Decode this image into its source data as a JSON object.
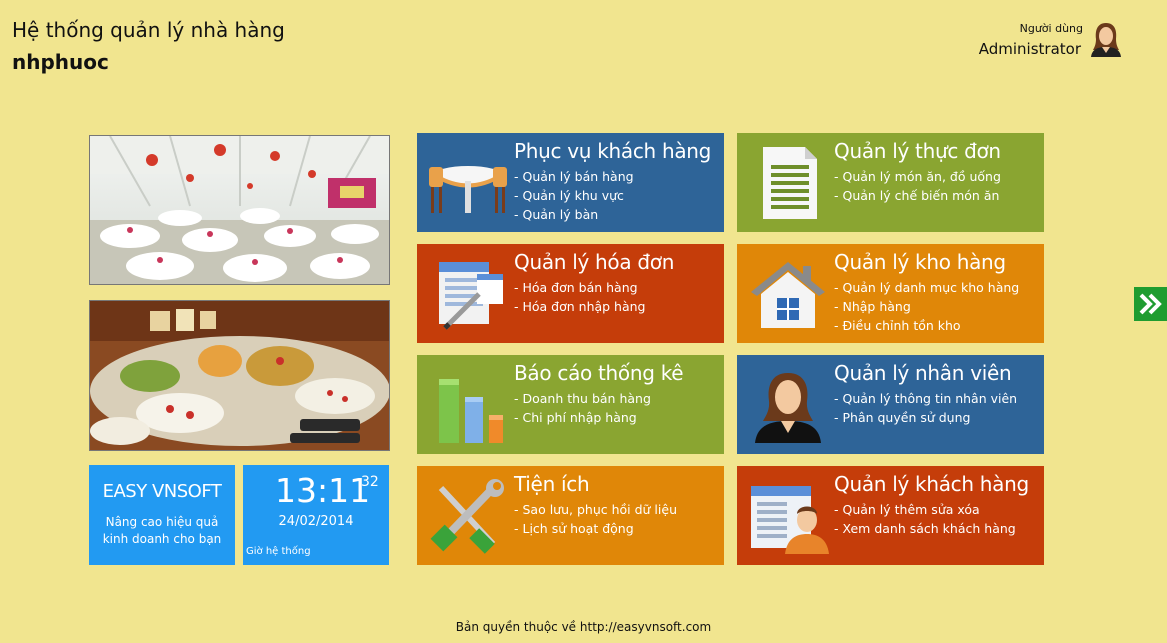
{
  "header": {
    "title": "Hệ thống quản lý nhà hàng",
    "subtitle": "nhphuoc",
    "user_label": "Người dùng",
    "user_name": "Administrator"
  },
  "promo": {
    "brand": "EASY VNSOFT",
    "tagline_1": "Nâng cao hiệu quả",
    "tagline_2": "kinh doanh cho bạn"
  },
  "clock": {
    "time": "13:11",
    "seconds": "32",
    "date": "24/02/2014",
    "caption": "Giờ hệ thống"
  },
  "tiles": [
    {
      "title": "Phục vụ khách hàng",
      "items": [
        "- Quản lý bán hàng",
        "- Quản lý khu vực",
        "- Quản lý bàn"
      ],
      "color": "#2e6498",
      "icon": "dining-table-icon"
    },
    {
      "title": "Quản lý thực đơn",
      "items": [
        "- Quản lý món ăn, đồ uống",
        "- Quản lý chế biến món ăn"
      ],
      "color": "#8aa531",
      "icon": "menu-document-icon"
    },
    {
      "title": "Quản lý hóa đơn",
      "items": [
        "- Hóa đơn bán hàng",
        "- Hóa đơn nhập hàng"
      ],
      "color": "#c53d0a",
      "icon": "invoice-pen-icon"
    },
    {
      "title": "Quản lý kho hàng",
      "items": [
        "- Quản lý danh mục kho hàng",
        "- Nhập hàng",
        "- Điều chỉnh tồn kho"
      ],
      "color": "#e08708",
      "icon": "warehouse-house-icon"
    },
    {
      "title": "Báo cáo thống kê",
      "items": [
        "- Doanh thu bán hàng",
        "- Chi phí nhập hàng"
      ],
      "color": "#8aa531",
      "icon": "bar-chart-icon"
    },
    {
      "title": "Quản lý nhân viên",
      "items": [
        "- Quản lý thông tin nhân viên",
        "- Phân quyền sử dụng"
      ],
      "color": "#2e6498",
      "icon": "employee-icon"
    },
    {
      "title": "Tiện ích",
      "items": [
        "- Sao lưu, phục hồi dữ liệu",
        "- Lịch sử hoạt động"
      ],
      "color": "#e08708",
      "icon": "tools-icon"
    },
    {
      "title": "Quản lý khách hàng",
      "items": [
        "- Quản lý thêm sửa xóa",
        "- Xem danh sách khách hàng"
      ],
      "color": "#c53d0a",
      "icon": "customer-card-icon"
    }
  ],
  "footer": "Bản quyền thuộc về http://easyvnsoft.com"
}
